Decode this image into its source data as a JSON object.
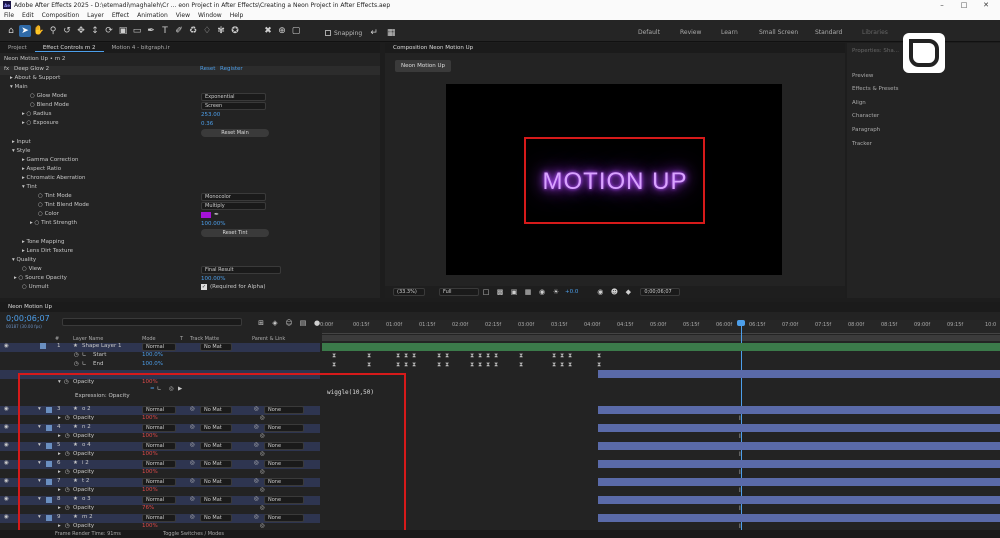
{
  "title_bar": {
    "app_badge": "Ae",
    "title": "Adobe After Effects 2025 - D:\\etemadi\\maghaleh\\Cr ... eon Project in After Effects\\Creating a Neon Project in After Effects.aep"
  },
  "menu": [
    "File",
    "Edit",
    "Composition",
    "Layer",
    "Effect",
    "Animation",
    "View",
    "Window",
    "Help"
  ],
  "toolbar": {
    "snapping_label": "Snapping",
    "workspaces": [
      "Default",
      "Review",
      "Learn",
      "Small Screen",
      "Standard",
      "Libraries"
    ]
  },
  "left_tabs": [
    "Project",
    "Effect Controls m 2",
    "Motion 4 - bitgraph.ir"
  ],
  "effect_controls": {
    "layer_path": "Neon Motion Up • m 2",
    "effect_name": "Deep Glow 2",
    "reset_label": "Reset",
    "register_label": "Register",
    "about": "About & Support",
    "main": "Main",
    "glow_mode_label": "Glow Mode",
    "glow_mode_value": "Exponential",
    "blend_mode_label": "Blend Mode",
    "blend_mode_value": "Screen",
    "radius_label": "Radius",
    "radius_value": "253.00",
    "exposure_label": "Exposure",
    "exposure_value": "0.36",
    "reset_main": "Reset Main",
    "input": "Input",
    "style": "Style",
    "gamma": "Gamma Correction",
    "aspect": "Aspect Ratio",
    "chromatic": "Chromatic Aberration",
    "tint": "Tint",
    "tint_mode_label": "Tint Mode",
    "tint_mode_value": "Monocolor",
    "tint_blend_label": "Tint Blend Mode",
    "tint_blend_value": "Multiply",
    "color_label": "Color",
    "tint_color": "#a412d6",
    "tint_strength_label": "Tint Strength",
    "tint_strength_value": "100.00%",
    "reset_tint": "Reset Tint",
    "tone_mapping": "Tone Mapping",
    "lens_dirt": "Lens Dirt Texture",
    "quality": "Quality",
    "view_label": "View",
    "view_value": "Final Result",
    "source_opacity_label": "Source Opacity",
    "source_opacity_value": "100.00%",
    "unmult_label": "Unmult",
    "unmult_value": "(Required for Alpha)"
  },
  "composition": {
    "tab": "Composition Neon Motion Up",
    "sub_tab": "Neon Motion Up",
    "neon_text": "MOTION UP",
    "neon_color": "#b14dff",
    "zoom": "(33.3%)",
    "resolution": "Full",
    "exposure": "+0.0",
    "timecode": "0;00;06;07"
  },
  "right_panel": {
    "items": [
      "Properties: Sha...",
      "Preview",
      "Effects & Presets",
      "Align",
      "Character",
      "Paragraph",
      "Tracker"
    ]
  },
  "timeline": {
    "tab": "Neon Motion Up",
    "timecode": "0;00;06;07",
    "frames": "00187 (30.00 fps)",
    "columns": [
      "#",
      "Layer Name",
      "Mode",
      "T",
      "Track Matte",
      "Parent & Link"
    ],
    "ruler": [
      "0:00f",
      "00:15f",
      "01:00f",
      "01:15f",
      "02:00f",
      "02:15f",
      "03:00f",
      "03:15f",
      "04:00f",
      "04:15f",
      "05:00f",
      "05:15f",
      "06:00f",
      "06:15f",
      "07:00f",
      "07:15f",
      "08:00f",
      "08:15f",
      "09:00f",
      "09:15f",
      "10:0"
    ],
    "shape_layer": {
      "num": "1",
      "name": "Shape Layer 1",
      "mode": "Normal",
      "matte": "No Mat"
    },
    "start_label": "Start",
    "start_value": "100.0%",
    "end_label": "End",
    "end_value": "100.0%",
    "opacity_label": "Opacity",
    "expression_label": "Expression: Opacity",
    "expression_text": "wiggle(10,50)",
    "layers": [
      {
        "num": "3",
        "name": "o 2",
        "opacity": "100%"
      },
      {
        "num": "4",
        "name": "n 2",
        "opacity": "100%"
      },
      {
        "num": "5",
        "name": "o 4",
        "opacity": "100%"
      },
      {
        "num": "6",
        "name": "i 2",
        "opacity": "100%"
      },
      {
        "num": "7",
        "name": "t 2",
        "opacity": "100%"
      },
      {
        "num": "8",
        "name": "o 3",
        "opacity": "76%"
      },
      {
        "num": "9",
        "name": "m 2",
        "opacity": "100%"
      }
    ],
    "mode_value": "Normal",
    "matte_value": "No Mat",
    "parent_value": "None",
    "top_opacity": "100%",
    "footer_render": "Frame Render Time: 91ms",
    "footer_toggle": "Toggle Switches / Modes"
  }
}
